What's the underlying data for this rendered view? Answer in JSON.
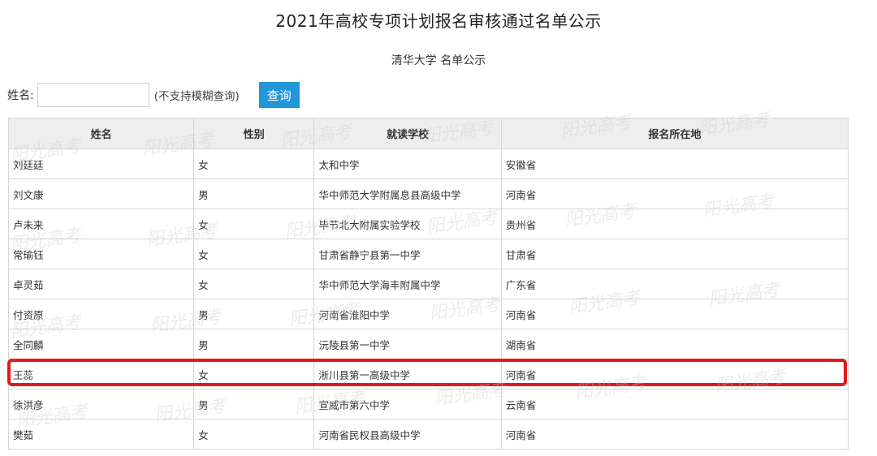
{
  "page": {
    "title": "2021年高校专项计划报名审核通过名单公示",
    "subtitle": "清华大学 名单公示"
  },
  "search": {
    "label": "姓名:",
    "value": "",
    "placeholder": "",
    "hint": "(不支持模糊查询)",
    "button_label": "查询"
  },
  "table": {
    "headers": [
      "姓名",
      "性别",
      "就读学校",
      "报名所在地"
    ],
    "rows": [
      {
        "name": "刘廷廷",
        "gender": "女",
        "school": "太和中学",
        "region": "安徽省"
      },
      {
        "name": "刘文康",
        "gender": "男",
        "school": "华中师范大学附属息县高级中学",
        "region": "河南省"
      },
      {
        "name": "卢未来",
        "gender": "女",
        "school": "毕节北大附属实验学校",
        "region": "贵州省"
      },
      {
        "name": "常瑜钰",
        "gender": "女",
        "school": "甘肃省静宁县第一中学",
        "region": "甘肃省"
      },
      {
        "name": "卓灵茹",
        "gender": "女",
        "school": "华中师范大学海丰附属中学",
        "region": "广东省"
      },
      {
        "name": "付资原",
        "gender": "男",
        "school": "河南省淮阳中学",
        "region": "河南省"
      },
      {
        "name": "全同麟",
        "gender": "男",
        "school": "沅陵县第一中学",
        "region": "湖南省"
      },
      {
        "name": "王蕊",
        "gender": "女",
        "school": "淅川县第一高级中学",
        "region": "河南省"
      },
      {
        "name": "徐洪彦",
        "gender": "男",
        "school": "宣威市第六中学",
        "region": "云南省"
      },
      {
        "name": "樊茹",
        "gender": "女",
        "school": "河南省民权县高级中学",
        "region": "河南省"
      }
    ]
  },
  "watermark": {
    "text": "阳光高考"
  },
  "colors": {
    "accent": "#2196d9",
    "highlight": "#e21a1a",
    "header_bg": "#eeeeee"
  }
}
